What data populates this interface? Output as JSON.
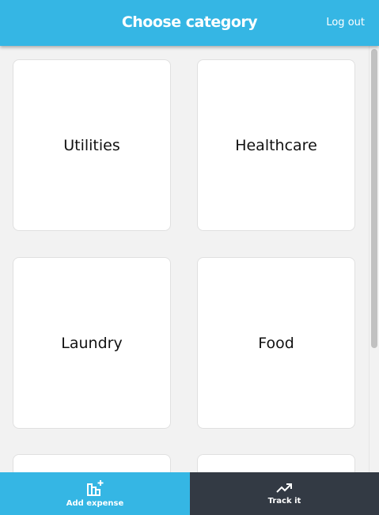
{
  "header": {
    "title": "Choose category",
    "logout_label": "Log out"
  },
  "categories": [
    {
      "label": "Utilities"
    },
    {
      "label": "Healthcare"
    },
    {
      "label": "Laundry"
    },
    {
      "label": "Food"
    },
    {
      "label": ""
    },
    {
      "label": ""
    }
  ],
  "nav": {
    "items": [
      {
        "label": "Add expense",
        "icon": "bar-chart-plus-icon",
        "active": true
      },
      {
        "label": "Track it",
        "icon": "trending-up-icon",
        "active": false
      }
    ]
  },
  "colors": {
    "accent": "#35b6e4",
    "nav_dark": "#333a44",
    "background": "#f2f2f2"
  }
}
